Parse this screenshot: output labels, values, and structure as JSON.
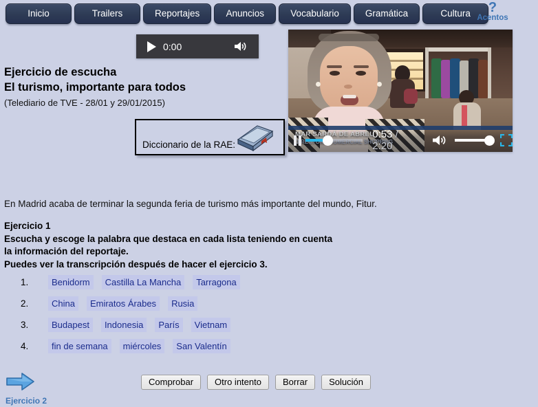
{
  "nav": {
    "items": [
      {
        "label": "Inicio",
        "name": "nav-inicio"
      },
      {
        "label": "Trailers",
        "name": "nav-trailers"
      },
      {
        "label": "Reportajes",
        "name": "nav-reportajes"
      },
      {
        "label": "Anuncios",
        "name": "nav-anuncios"
      },
      {
        "label": "Vocabulario",
        "name": "nav-vocabulario"
      },
      {
        "label": "Gramática",
        "name": "nav-gramatica"
      },
      {
        "label": "Cultura",
        "name": "nav-cultura"
      }
    ],
    "help": {
      "icon": "question-mark-icon",
      "glyph": "?",
      "label": "Acentos"
    }
  },
  "audio_player": {
    "play_icon": "play-icon",
    "time": "0:00",
    "volume_icon": "speaker-icon"
  },
  "headings": {
    "title": "Ejercicio de escucha",
    "subtitle": "El turismo, importante para todos",
    "source": "(Telediario de TVE - 28/01 y 29/01/2015)"
  },
  "dictionary": {
    "label": "Diccionario de la RAE:",
    "icon": "book-icon"
  },
  "video": {
    "caption": "MAR SARDÁ DE ABREU",
    "caption_sub": "DIRECTORA COMERCIAL SHOPPING",
    "pause_icon": "pause-icon",
    "current_time": "0:53",
    "separator": "/",
    "total_time": "2:20",
    "volume_icon": "speaker-icon",
    "fullscreen_icon": "fullscreen-icon",
    "progress_percent": 38
  },
  "intro_text": "En Madrid acaba de terminar la segunda feria de turismo más importante del mundo, Fitur.",
  "instructions": {
    "line1": "Ejercicio 1",
    "line2": "Escucha y escoge la palabra que destaca en cada lista teniendo en cuenta",
    "line3": "la información del reportaje.",
    "line4": "Puedes ver la transcripción después de hacer el ejercicio 3."
  },
  "questions": [
    {
      "number": "1.",
      "options": [
        "Benidorm",
        "Castilla La Mancha",
        "Tarragona"
      ]
    },
    {
      "number": "2.",
      "options": [
        "China",
        "Emiratos Árabes",
        "Rusia"
      ]
    },
    {
      "number": "3.",
      "options": [
        "Budapest",
        "Indonesia",
        "París",
        "Vietnam"
      ]
    },
    {
      "number": "4.",
      "options": [
        "fin de semana",
        "miércoles",
        "San Valentín"
      ]
    }
  ],
  "action_buttons": [
    {
      "label": "Comprobar",
      "name": "comprobar-button"
    },
    {
      "label": "Otro intento",
      "name": "otro-intento-button"
    },
    {
      "label": "Borrar",
      "name": "borrar-button"
    },
    {
      "label": "Solución",
      "name": "solucion-button"
    }
  ],
  "next_exercise": {
    "icon": "arrow-right-icon",
    "label": "Ejercicio 2"
  },
  "colors": {
    "page_background": "#ccd1e5",
    "nav_button": "#2e3b55",
    "link_blue": "#3f76b5",
    "option_background": "#c3c8ea",
    "option_text": "#1b2c8c",
    "progress_fill": "#29b6e8"
  }
}
